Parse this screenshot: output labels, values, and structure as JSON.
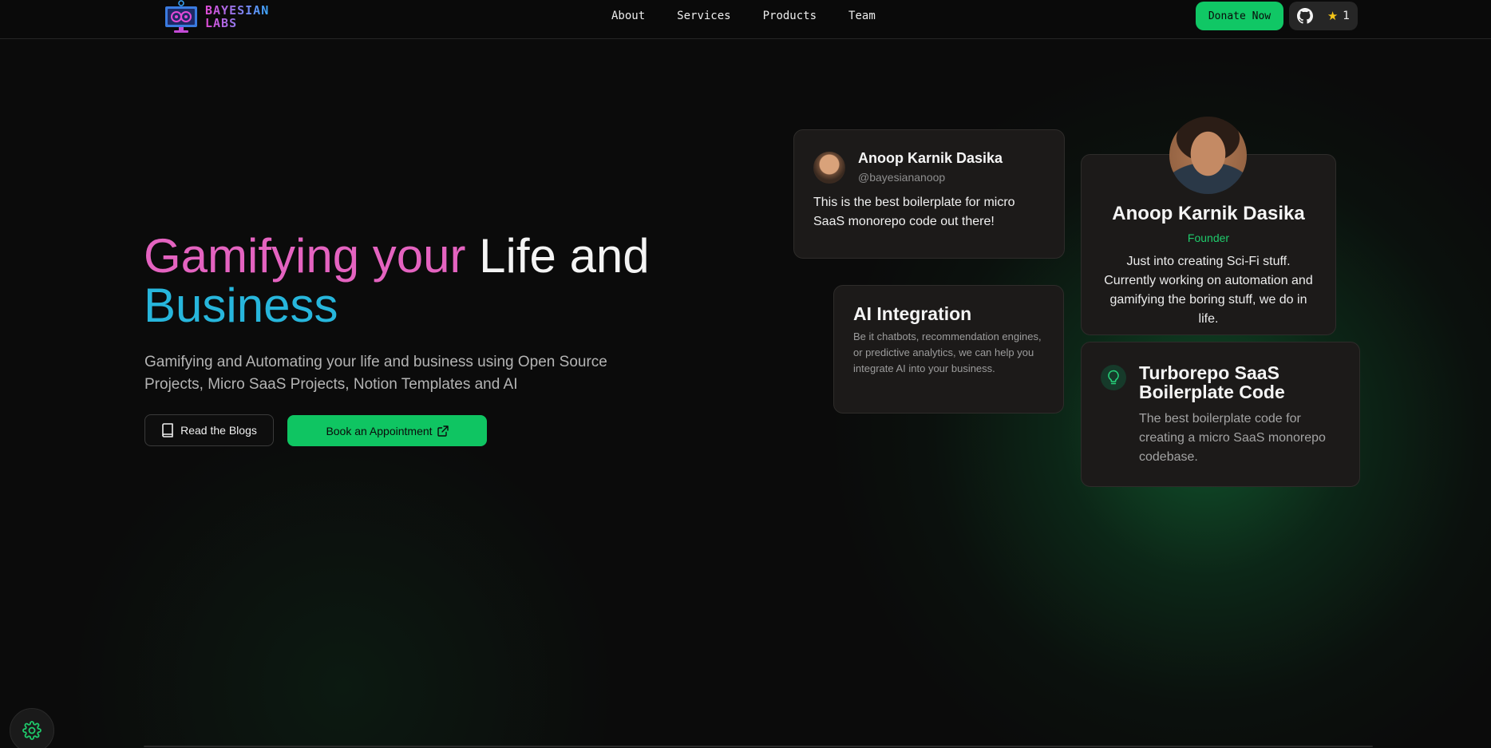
{
  "brand": {
    "name_line1": "BAYESIAN",
    "name_line2": "LABS",
    "gradient_start": "#e24bd6",
    "gradient_end": "#3aa7ff"
  },
  "nav": {
    "links": [
      "About",
      "Services",
      "Products",
      "Team"
    ],
    "donate_label": "Donate Now",
    "github_stars": "1",
    "accent": "#10c765"
  },
  "hero": {
    "title_part1": "Gamifying your",
    "title_part2": "Life and",
    "title_part3": "Business",
    "subtitle": "Gamifying and Automating your life and business using Open Source Projects, Micro SaaS Projects, Notion Templates and AI",
    "blogs_button": "Read the Blogs",
    "appointment_button": "Book an Appointment",
    "colors": {
      "pink": "#e463c0",
      "cyan": "#27b6dc"
    }
  },
  "testimonial": {
    "name": "Anoop Karnik Dasika",
    "handle": "@bayesiananoop",
    "quote": "This is the best boilerplate for micro SaaS monorepo code out there!"
  },
  "ai_card": {
    "title": "AI Integration",
    "description": "Be it chatbots, recommendation engines, or predictive analytics, we can help you integrate AI into your business."
  },
  "profile": {
    "name": "Anoop Karnik Dasika",
    "role": "Founder",
    "bio": "Just into creating Sci-Fi stuff. Currently working on automation and gamifying the boring stuff, we do in life."
  },
  "turbo_card": {
    "title": "Turborepo SaaS Boilerplate Code",
    "description": "The best boilerplate code for creating a micro SaaS monorepo codebase.",
    "icon": "lightbulb-icon"
  },
  "icons": {
    "settings": "gear-icon",
    "github": "github-icon",
    "star": "star-icon",
    "book": "book-icon",
    "external": "external-link-icon"
  }
}
